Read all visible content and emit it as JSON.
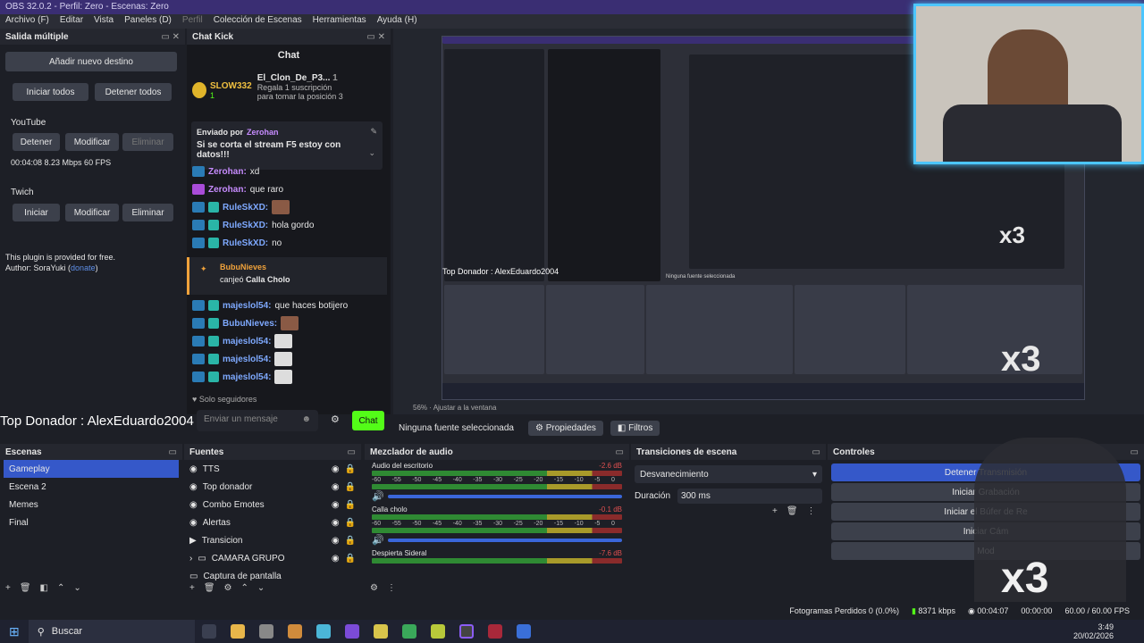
{
  "window": {
    "title": "OBS 32.0.2 - Perfil: Zero - Escenas: Zero"
  },
  "menu": [
    "Archivo (F)",
    "Editar",
    "Vista",
    "Paneles (D)",
    "Perfil",
    "Colección de Escenas",
    "Herramientas",
    "Ayuda (H)"
  ],
  "multistream": {
    "title": "Salida múltiple",
    "add_label": "Añadir nuevo destino",
    "start_all": "Iniciar todos",
    "stop_all": "Detener todos",
    "youtube": {
      "label": "YouTube",
      "stop": "Detener",
      "modify": "Modificar",
      "delete": "Eliminar",
      "stats": "00:04:08  8.23 Mbps  60 FPS"
    },
    "twitch": {
      "label": "Twich",
      "start": "Iniciar",
      "modify": "Modificar",
      "delete": "Eliminar"
    },
    "note_line1": "This plugin is provided for free.",
    "note_line2": "Author: SoraYuki (",
    "note_link": "donate",
    "note_end": ")"
  },
  "chat": {
    "title": "Chat Kick",
    "header": "Chat",
    "top_user": "SLOW332",
    "top_user_count": "1",
    "gift_user": "El_Clon_De_P3...",
    "gift_count": "1",
    "gift_text1": "Regala 1 suscripción",
    "gift_text2": "para tomar la posición 3",
    "pinned_by": "Enviado por",
    "pinned_user": "Zerohan",
    "pinned_msg": "Si se corta el stream F5 estoy con datos!!!",
    "messages": [
      {
        "user": "Zerohan:",
        "text": "xd",
        "color": "p"
      },
      {
        "user": "Zerohan:",
        "text": "que raro",
        "color": "p"
      },
      {
        "user": "RuleSkXD:",
        "text": "",
        "color": "b",
        "emote": true
      },
      {
        "user": "RuleSkXD:",
        "text": "hola gordo",
        "color": "b"
      },
      {
        "user": "RuleSkXD:",
        "text": "no",
        "color": "b"
      }
    ],
    "reward_user": "BubuNieves",
    "reward_text": "canjeó",
    "reward_item": "Calla Cholo",
    "messages2": [
      {
        "user": "majeslol54:",
        "text": "que haces botijero",
        "color": "b"
      },
      {
        "user": "BubuNieves:",
        "text": "",
        "color": "b",
        "emote": true
      },
      {
        "user": "majeslol54:",
        "text": "",
        "color": "b",
        "emote": true
      },
      {
        "user": "majeslol54:",
        "text": "",
        "color": "b",
        "emote": true
      },
      {
        "user": "majeslol54:",
        "text": "",
        "color": "b",
        "emote": true
      }
    ],
    "followers_only": "Solo seguidores",
    "input_placeholder": "Enviar un mensaje",
    "send_label": "Chat"
  },
  "overlay": {
    "top_donor": "Top Donador : AlexEduardo2004",
    "x3": "x3"
  },
  "status": {
    "no_source": "Ninguna fuente seleccionada",
    "properties": "Propiedades",
    "filters": "Filtros"
  },
  "scenes": {
    "title": "Escenas",
    "items": [
      "Gameplay",
      "Escena 2",
      "Memes",
      "Final"
    ]
  },
  "sources": {
    "title": "Fuentes",
    "items": [
      "TTS",
      "Top donador",
      "Combo Emotes",
      "Alertas",
      "Transicion",
      "CAMARA GRUPO",
      "Captura de pantalla"
    ]
  },
  "mixer": {
    "title": "Mezclador de audio",
    "scale": [
      "-60",
      "-55",
      "-50",
      "-45",
      "-40",
      "-35",
      "-30",
      "-25",
      "-20",
      "-15",
      "-10",
      "-5",
      "0"
    ],
    "channels": [
      {
        "name": "Audio del escritorio",
        "db": "-2.6 dB"
      },
      {
        "name": "Calla cholo",
        "db": "-0.1 dB"
      },
      {
        "name": "Despierta Sideral",
        "db": "-7.6 dB"
      }
    ]
  },
  "transitions": {
    "title": "Transiciones de escena",
    "selected": "Desvanecimiento",
    "duration_label": "Duración",
    "duration_value": "300 ms"
  },
  "controls": {
    "title": "Controles",
    "stop_stream": "Detener Transmisión",
    "start_rec": "Iniciar Grabación",
    "replay": "Iniciar el Búfer de Re",
    "vcam": "Iniciar Cám",
    "mode": "Mod"
  },
  "footer": {
    "dropped": "Fotogramas Perdidos 0 (0.0%)",
    "kbps": "8371 kbps",
    "time1": "00:04:07",
    "time2": "00:00:00",
    "fps": "60.00 / 60.00 FPS"
  },
  "taskbar": {
    "search": "Buscar",
    "time": "3:49",
    "date": "20/02/2026"
  },
  "nested": {
    "no_source": "Ninguna fuente seleccionada",
    "fit": "Ajustar a la ventana",
    "zoom": "56%"
  }
}
